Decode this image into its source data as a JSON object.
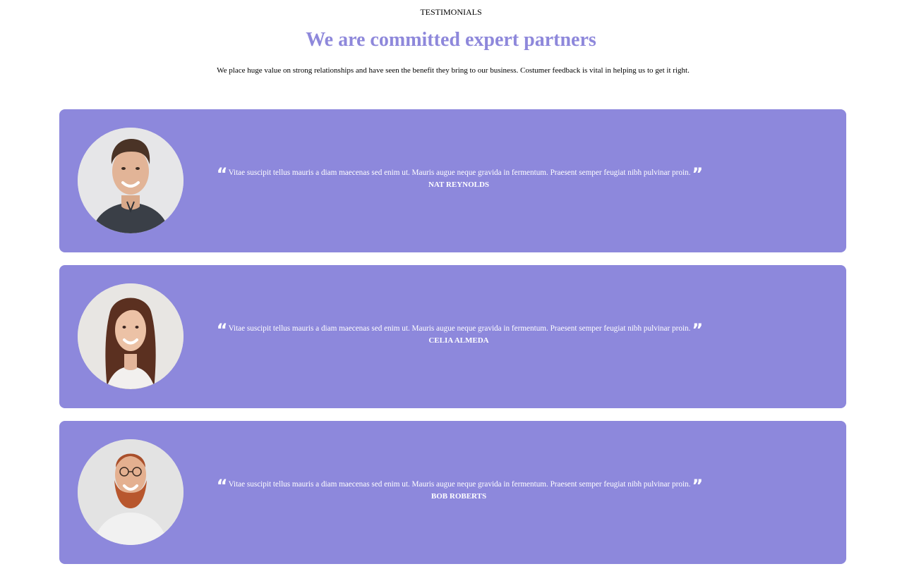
{
  "header": {
    "eyebrow": "TESTIMONIALS",
    "title": "We are committed expert partners",
    "subtitle": "We place huge value on strong relationships and have seen the benefit they bring to our business. Costumer feedback is vital in helping us to get it right."
  },
  "colors": {
    "accent": "#8d88dc",
    "title": "#8e88db",
    "card_text": "#ffffff"
  },
  "testimonials": [
    {
      "quote": "Vitae suscipit tellus mauris a diam maecenas sed enim ut. Mauris augue neque gravida in fermentum. Praesent semper feugiat nibh pulvinar proin.",
      "author": "NAT REYNOLDS",
      "open_mark": "“",
      "close_mark": "”"
    },
    {
      "quote": "Vitae suscipit tellus mauris a diam maecenas sed enim ut. Mauris augue neque gravida in fermentum. Praesent semper feugiat nibh pulvinar proin.",
      "author": "CELIA ALMEDA",
      "open_mark": "“",
      "close_mark": "”"
    },
    {
      "quote": "Vitae suscipit tellus mauris a diam maecenas sed enim ut. Mauris augue neque gravida in fermentum. Praesent semper feugiat nibh pulvinar proin.",
      "author": "BOB ROBERTS",
      "open_mark": "“",
      "close_mark": "”"
    }
  ]
}
